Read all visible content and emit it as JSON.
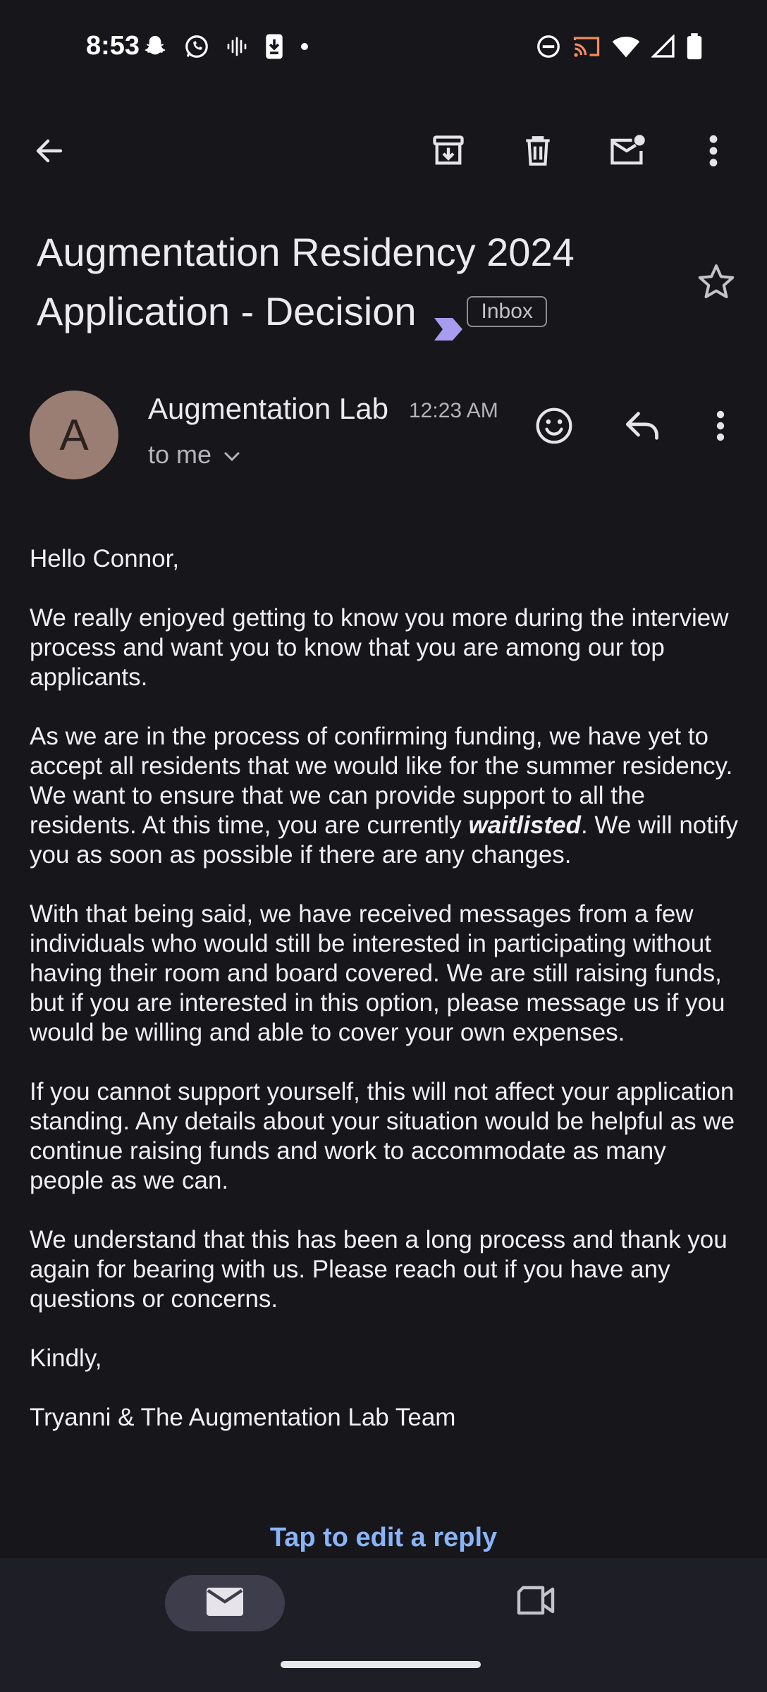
{
  "status_bar": {
    "time": "8:53",
    "left_icons": [
      "snapchat-icon",
      "whatsapp-icon",
      "voice-icon",
      "download-icon",
      "dot-icon"
    ],
    "right_icons": [
      "dnd-icon",
      "cast-icon",
      "wifi-icon",
      "signal-icon",
      "battery-icon"
    ]
  },
  "toolbar": {
    "icons": [
      "back-icon",
      "archive-icon",
      "delete-icon",
      "mark-unread-icon",
      "more-vert-icon"
    ]
  },
  "email": {
    "subject_line1": "Augmentation Residency 2024",
    "subject_line2": "Application - Decision",
    "label": "Inbox",
    "sender_initial": "A",
    "sender_name": "Augmentation Lab",
    "time": "12:23 AM",
    "to": "to me",
    "body": {
      "greeting": "Hello Connor,",
      "p1": "We really enjoyed getting to know you more during the interview process and want you to know that you are among our top applicants.",
      "p2_before": "As we are in the process of confirming funding, we have yet to accept all residents that we would like for the summer residency. We want to ensure that we can provide support to all the residents. At this time, you are currently ",
      "p2_emphasis": "waitlisted",
      "p2_after": ". We will notify you as soon as possible if there are any changes.",
      "p3": "With that being said, we have received messages from a few individuals who would still be interested in participating without having their room and board covered. We are still raising funds, but if you are interested in this option, please message us if you would be willing and able to cover your own expenses.",
      "p4": "If you cannot support yourself, this will not affect your application standing. Any details about your situation would be helpful as we continue raising funds and work to accommodate as many people as we can.",
      "p5": "We understand that this has been a long process and thank you again for bearing with us. Please reach out if you have any questions or concerns.",
      "signoff": "Kindly,",
      "signature": "Tryanni & The Augmentation Lab Team"
    }
  },
  "reply_prompt": "Tap to edit a reply",
  "bottom_nav": {
    "items": [
      "mail-icon",
      "meet-icon"
    ]
  },
  "colors": {
    "background": "#16161b",
    "nav_background": "#1e1e26",
    "link_blue": "#8ab4f8",
    "label_purple": "#a89cf0",
    "avatar": "#9a7e74"
  }
}
